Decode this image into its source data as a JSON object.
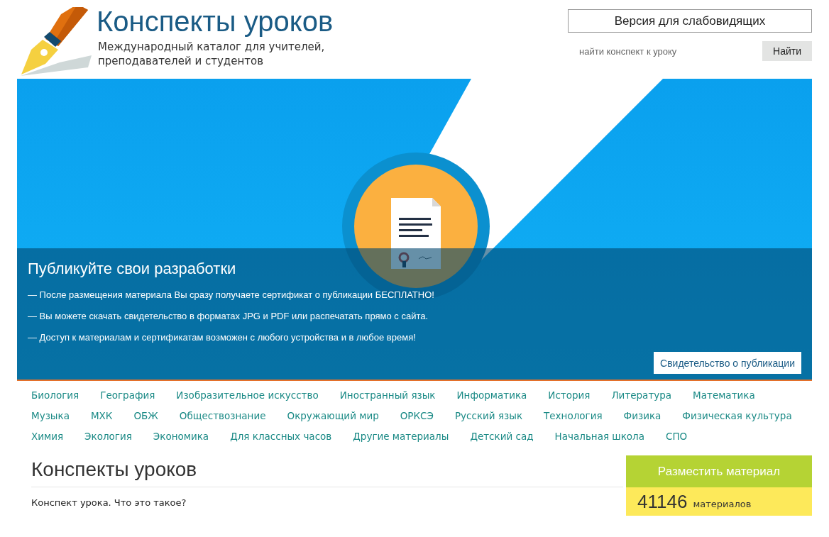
{
  "header": {
    "title": "Конспекты уроков",
    "subtitle_lines": [
      "Международный каталог для учителей,",
      "преподавателей и студентов"
    ],
    "accessibility_button": "Версия для слабовидящих",
    "search": {
      "placeholder": "найти конспект к уроку",
      "button": "Найти"
    }
  },
  "banner": {
    "heading": "Публикуйте свои разработки",
    "points": [
      "— После размещения материала Вы сразу получаете сертификат о публикации БЕСПЛАТНО!",
      "— Вы можете скачать свидетельство в форматах JPG и PDF или распечатать прямо с сайта.",
      "— Доступ к материалам и сертификатам возможен с любого устройства и в любое время!"
    ],
    "button": "Свидетельство о публикации"
  },
  "subjects": [
    "Биология",
    "География",
    "Изобразительное искусство",
    "Иностранный язык",
    "Информатика",
    "История",
    "Литература",
    "Математика",
    "Музыка",
    "МХК",
    "ОБЖ",
    "Обществознание",
    "Окружающий мир",
    "ОРКСЭ",
    "Русский язык",
    "Технология",
    "Физика",
    "Физическая культура",
    "Химия",
    "Экология",
    "Экономика",
    "Для классных часов",
    "Другие материалы",
    "Детский сад",
    "Начальная школа",
    "СПО"
  ],
  "content": {
    "heading": "Конспекты уроков",
    "intro": "Конспект урока. Что это такое?"
  },
  "sidebar": {
    "publish_button": "Разместить материал",
    "count": "41146",
    "count_label": "материалов"
  }
}
